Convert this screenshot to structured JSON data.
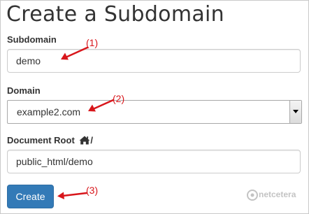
{
  "page": {
    "title": "Create a Subdomain"
  },
  "form": {
    "subdomain": {
      "label": "Subdomain",
      "value": "demo"
    },
    "domain": {
      "label": "Domain",
      "selected": "example2.com"
    },
    "document_root": {
      "label": "Document Root",
      "label_suffix": "/",
      "value": "public_html/demo"
    },
    "submit_label": "Create"
  },
  "annotations": {
    "step1": "(1)",
    "step2": "(2)",
    "step3": "(3)"
  },
  "watermark": {
    "text": "netcetera"
  },
  "icons": {
    "home": "home-icon",
    "dropdown": "chevron-down-icon",
    "arrow": "red-arrow-icon",
    "logo": "netcetera-logo-icon"
  },
  "colors": {
    "button_bg": "#337ab7",
    "annotation": "#d8161b",
    "title": "#333333"
  }
}
